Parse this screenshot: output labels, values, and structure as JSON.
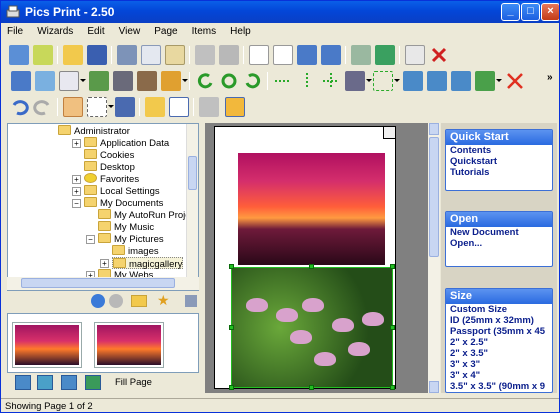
{
  "window": {
    "title": "Pics Print - 2.50"
  },
  "menu": [
    "File",
    "Wizards",
    "Edit",
    "View",
    "Page",
    "Items",
    "Help"
  ],
  "tree": {
    "items": [
      {
        "label": "Administrator"
      },
      {
        "label": "Application Data"
      },
      {
        "label": "Cookies"
      },
      {
        "label": "Desktop"
      },
      {
        "label": "Favorites"
      },
      {
        "label": "Local Settings"
      },
      {
        "label": "My Documents"
      },
      {
        "label": "My AutoRun Projects"
      },
      {
        "label": "My Music"
      },
      {
        "label": "My Pictures"
      },
      {
        "label": "images"
      },
      {
        "label": "magicgallery"
      },
      {
        "label": "My Webs"
      }
    ]
  },
  "bottom": {
    "fill_page": "Fill Page"
  },
  "panels": {
    "quickstart": {
      "title": "Quick Start",
      "items": [
        "Contents",
        "Quickstart",
        "Tutorials"
      ]
    },
    "open": {
      "title": "Open",
      "items": [
        "New Document",
        "Open..."
      ]
    },
    "size": {
      "title": "Size",
      "items": [
        "Custom Size",
        "ID (25mm x 32mm)",
        "Passport (35mm x 45",
        "2\" x 2.5\"",
        "2\" x 3.5\"",
        "3\" x 3\"",
        "3\" x 4\"",
        "3.5\" x 3.5\" (90mm x 9"
      ]
    }
  },
  "status": {
    "text": "Showing Page 1 of 2"
  },
  "colors": {
    "titlebar": "#0a5fe8",
    "panel_header": "#2a6ae0",
    "link": "#0a1e8c"
  }
}
